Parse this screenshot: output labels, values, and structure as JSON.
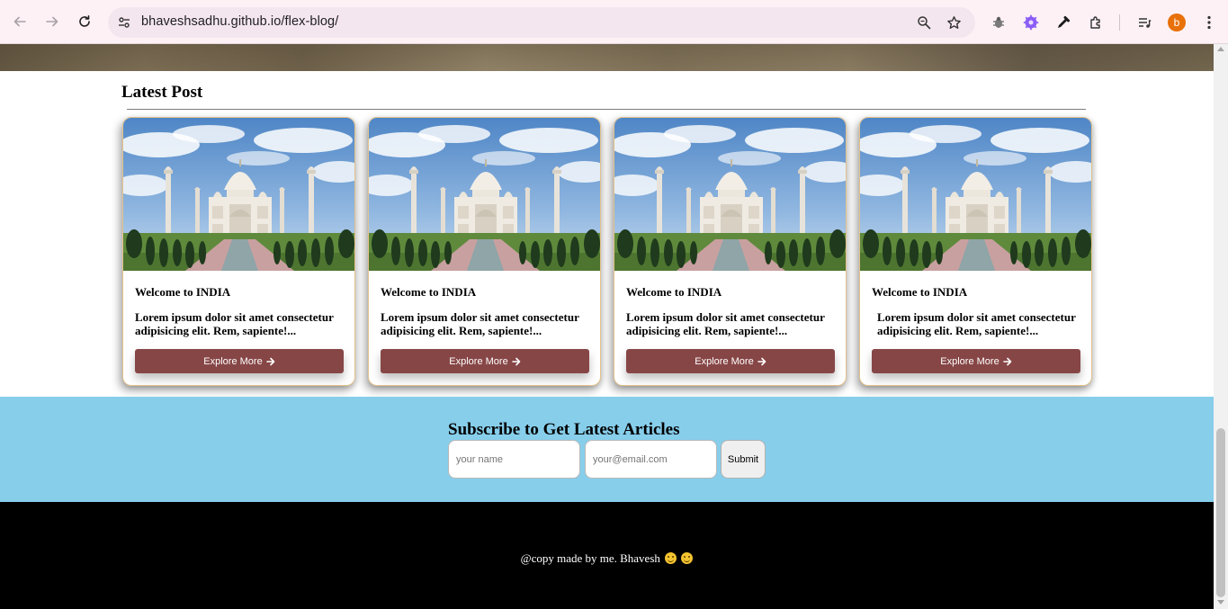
{
  "browser": {
    "url": "bhaveshsadhu.github.io/flex-blog/",
    "profile_initial": "b",
    "profile_color": "#e8710a"
  },
  "latest": {
    "heading": "Latest Post",
    "cards": [
      {
        "title": "Welcome to INDIA",
        "text": "Lorem ipsum dolor sit amet consectetur adipisicing elit. Rem, sapiente!...",
        "button": "Explore More",
        "image": "taj-mahal-photo"
      },
      {
        "title": "Welcome to INDIA",
        "text": "Lorem ipsum dolor sit amet consectetur adipisicing elit. Rem, sapiente!...",
        "button": "Explore More",
        "image": "taj-mahal-photo"
      },
      {
        "title": "Welcome to INDIA",
        "text": "Lorem ipsum dolor sit amet consectetur adipisicing elit. Rem, sapiente!...",
        "button": "Explore More",
        "image": "taj-mahal-photo"
      },
      {
        "title": "Welcome to INDIA",
        "text": "Lorem ipsum dolor sit amet consectetur adipisicing elit. Rem, sapiente!...",
        "button": "Explore More",
        "image": "taj-mahal-photo"
      }
    ]
  },
  "subscribe": {
    "heading": "Subscribe to Get Latest Articles",
    "name_placeholder": "your name",
    "email_placeholder": "your@email.com",
    "submit": "Submit",
    "background": "#87ceeb"
  },
  "footer": {
    "text": "@copy made by me. Bhavesh"
  },
  "colors": {
    "button": "#874646",
    "card_border": "#e3c28c"
  }
}
